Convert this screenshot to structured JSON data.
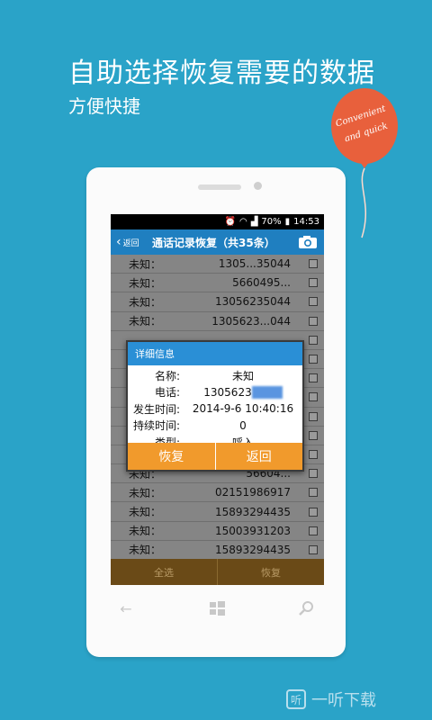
{
  "promo": {
    "headline": "自助选择恢复需要的数据",
    "subline": "方便快捷",
    "balloon_line1": "Convenient",
    "balloon_line2": "and quick"
  },
  "statusbar": {
    "battery": "70%",
    "time": "14:53"
  },
  "titlebar": {
    "back_label": "返回",
    "title": "通话记录恢复（共35条）"
  },
  "call_list": [
    {
      "name": "未知：",
      "number": "1305...35044"
    },
    {
      "name": "未知：",
      "number": "5660495..."
    },
    {
      "name": "未知：",
      "number": "13056235044"
    },
    {
      "name": "未知：",
      "number": "1305623...044"
    },
    {
      "name": "",
      "number": ""
    },
    {
      "name": "",
      "number": ""
    },
    {
      "name": "",
      "number": ""
    },
    {
      "name": "",
      "number": ""
    },
    {
      "name": "",
      "number": ""
    },
    {
      "name": "",
      "number": ""
    },
    {
      "name": "",
      "number": ""
    },
    {
      "name": "未知：",
      "number": "56604..."
    },
    {
      "name": "未知：",
      "number": "02151986917"
    },
    {
      "name": "未知：",
      "number": "15893294435"
    },
    {
      "name": "未知：",
      "number": "15003931203"
    },
    {
      "name": "未知：",
      "number": "15893294435"
    }
  ],
  "bottombar": {
    "select_all": "全选",
    "restore": "恢复"
  },
  "dialog": {
    "title": "详细信息",
    "name_label": "名称:",
    "name_value": "未知",
    "phone_label": "电话:",
    "phone_value": "1305623",
    "time_label": "发生时间:",
    "time_value": "2014-9-6 10:40:16",
    "duration_label": "持续时间:",
    "duration_value": "0",
    "type_label": "类型:",
    "type_value": "呼入",
    "restore_button": "恢复",
    "back_button": "返回"
  },
  "watermark": {
    "logo": "听",
    "text": "一听下载"
  },
  "colors": {
    "background": "#2aa3c8",
    "titlebar": "#1f7fc0",
    "dialog_title": "#2a8fd6",
    "dialog_button": "#f19a2c",
    "balloon": "#e8603c",
    "bottombar": "#6a4a17"
  }
}
